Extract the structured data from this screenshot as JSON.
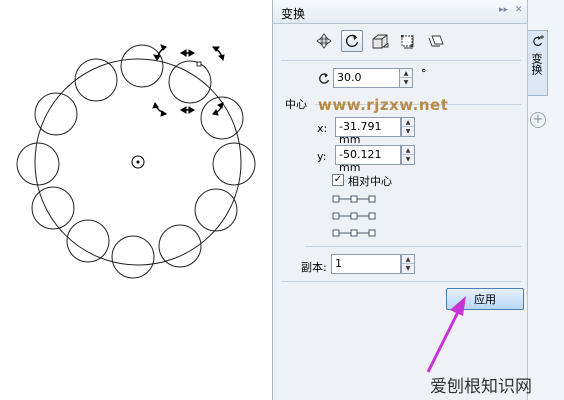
{
  "panel": {
    "title": "变换",
    "controls": [
      "▸▸",
      "✕"
    ]
  },
  "toolbar": {
    "tools": [
      {
        "icon": "position-icon"
      },
      {
        "icon": "rotate-icon",
        "active": true
      },
      {
        "icon": "scale-icon"
      },
      {
        "icon": "size-icon"
      },
      {
        "icon": "skew-icon"
      }
    ]
  },
  "rotation": {
    "value": "30.0",
    "unit": "°"
  },
  "center": {
    "section_label": "中心",
    "x_label": "x:",
    "x_value": "-31.791 mm",
    "y_label": "y:",
    "y_value": "-50.121 mm",
    "relative_center_label": "相对中心",
    "relative_center_checked": true
  },
  "copies": {
    "label": "副本:",
    "value": "1"
  },
  "apply_label": "应用",
  "side_tabs": {
    "transform_label": "变换"
  },
  "watermark": "www.rjzxw.net",
  "bottom_watermark": "爱刨根知识网",
  "colors": {
    "panel_bg": "#eef2f7",
    "accent_arrow": "#c733d6",
    "watermark": "#b07a2a"
  }
}
